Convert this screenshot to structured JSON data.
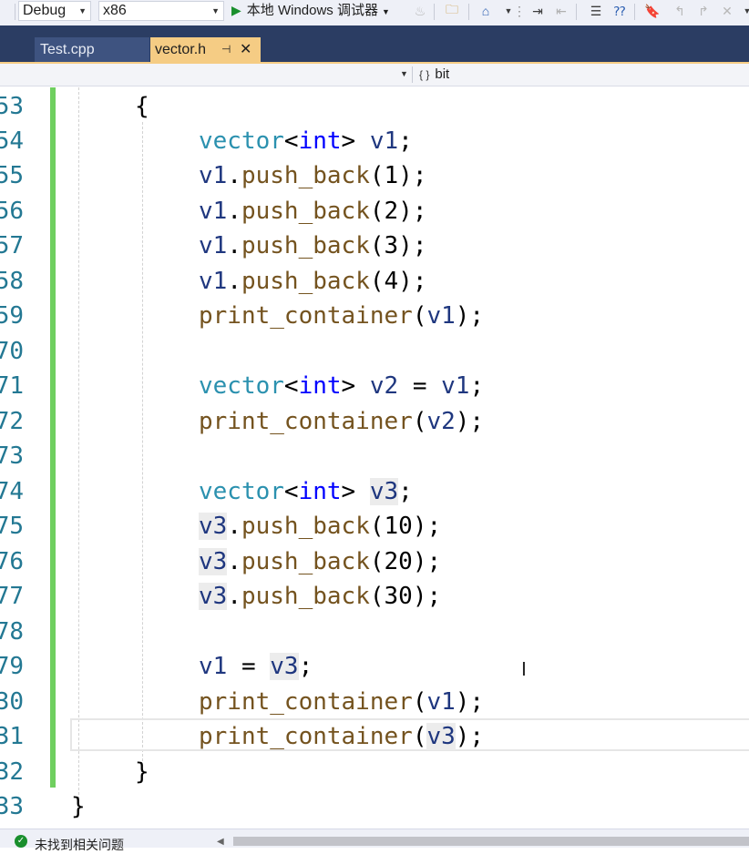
{
  "toolbar": {
    "config": "Debug",
    "platform": "x86",
    "run_label": "本地 Windows 调试器",
    "icons": [
      "flame-icon",
      "open-folder-icon",
      "home-icon",
      "grip-icon",
      "indent-icon",
      "outdent-icon",
      "comment-icon",
      "uncomment-icon",
      "bookmark-icon",
      "prev-bookmark-icon",
      "next-bookmark-icon",
      "clear-bookmark-icon"
    ]
  },
  "tabs": [
    {
      "label": "Test.cpp",
      "active": false
    },
    {
      "label": "vector.h",
      "active": true
    }
  ],
  "navbar": {
    "scope": "bit"
  },
  "editor": {
    "lines": [
      {
        "num": "53",
        "text": "{"
      },
      {
        "num": "54",
        "text": "vector<int> v1;"
      },
      {
        "num": "55",
        "text": "v1.push_back(1);"
      },
      {
        "num": "56",
        "text": "v1.push_back(2);"
      },
      {
        "num": "57",
        "text": "v1.push_back(3);"
      },
      {
        "num": "58",
        "text": "v1.push_back(4);"
      },
      {
        "num": "59",
        "text": "print_container(v1);"
      },
      {
        "num": "70",
        "text": ""
      },
      {
        "num": "71",
        "text": "vector<int> v2 = v1;"
      },
      {
        "num": "72",
        "text": "print_container(v2);"
      },
      {
        "num": "73",
        "text": ""
      },
      {
        "num": "74",
        "text": "vector<int> v3;"
      },
      {
        "num": "75",
        "text": "v3.push_back(10);"
      },
      {
        "num": "76",
        "text": "v3.push_back(20);"
      },
      {
        "num": "77",
        "text": "v3.push_back(30);"
      },
      {
        "num": "78",
        "text": ""
      },
      {
        "num": "79",
        "text": "v1 = v3;"
      },
      {
        "num": "30",
        "text": "print_container(v1);"
      },
      {
        "num": "31",
        "text": "print_container(v3);"
      },
      {
        "num": "32",
        "text": "}"
      },
      {
        "num": "33",
        "text": "}"
      }
    ]
  },
  "status": {
    "text": "未找到相关问题"
  },
  "colors": {
    "tab_active": "#f5cc84",
    "tab_bar": "#2b3d63",
    "change_bar": "#6fcf5f",
    "keyword": "#0000ff",
    "type": "#2b91af",
    "function": "#74531f",
    "variable": "#1f377f",
    "line_number": "#237893"
  }
}
